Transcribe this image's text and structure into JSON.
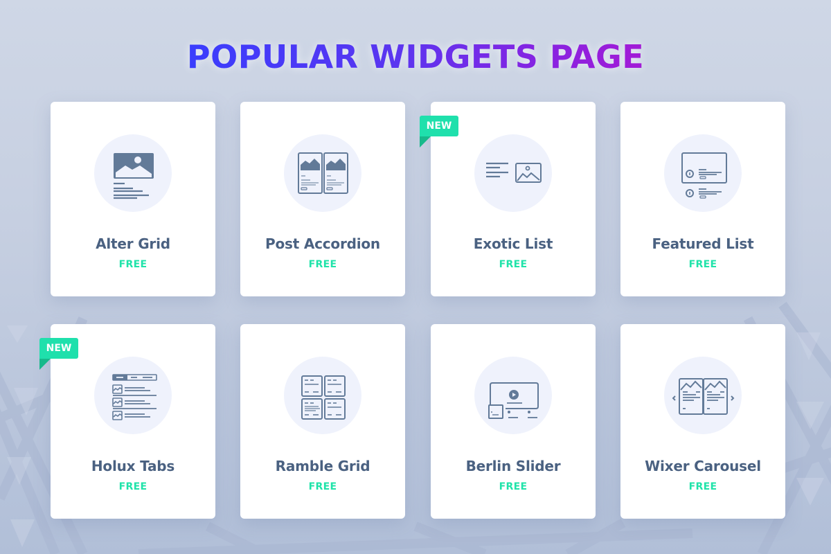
{
  "page": {
    "title": "POPULAR WIDGETS PAGE"
  },
  "colors": {
    "title_gradient_start": "#3a3dfd",
    "title_gradient_end": "#a31bd6",
    "name_text": "#4a6181",
    "price_text": "#1fe3a9",
    "badge_bg": "#1fe0ac",
    "icon_color": "#627a98",
    "icon_circle_bg": "#eff2fc"
  },
  "widgets": [
    {
      "name": "Alter Grid",
      "price": "FREE",
      "badge": null,
      "icon": "image-post-icon"
    },
    {
      "name": "Post Accordion",
      "price": "FREE",
      "badge": null,
      "icon": "accordion-cards-icon"
    },
    {
      "name": "Exotic List",
      "price": "FREE",
      "badge": "NEW",
      "icon": "text-image-list-icon"
    },
    {
      "name": "Featured List",
      "price": "FREE",
      "badge": null,
      "icon": "featured-list-icon"
    },
    {
      "name": "Holux Tabs",
      "price": "FREE",
      "badge": "NEW",
      "icon": "tabs-list-icon"
    },
    {
      "name": "Ramble Grid",
      "price": "FREE",
      "badge": null,
      "icon": "grid-icon"
    },
    {
      "name": "Berlin Slider",
      "price": "FREE",
      "badge": null,
      "icon": "video-slider-icon"
    },
    {
      "name": "Wixer Carousel",
      "price": "FREE",
      "badge": null,
      "icon": "carousel-icon"
    }
  ]
}
